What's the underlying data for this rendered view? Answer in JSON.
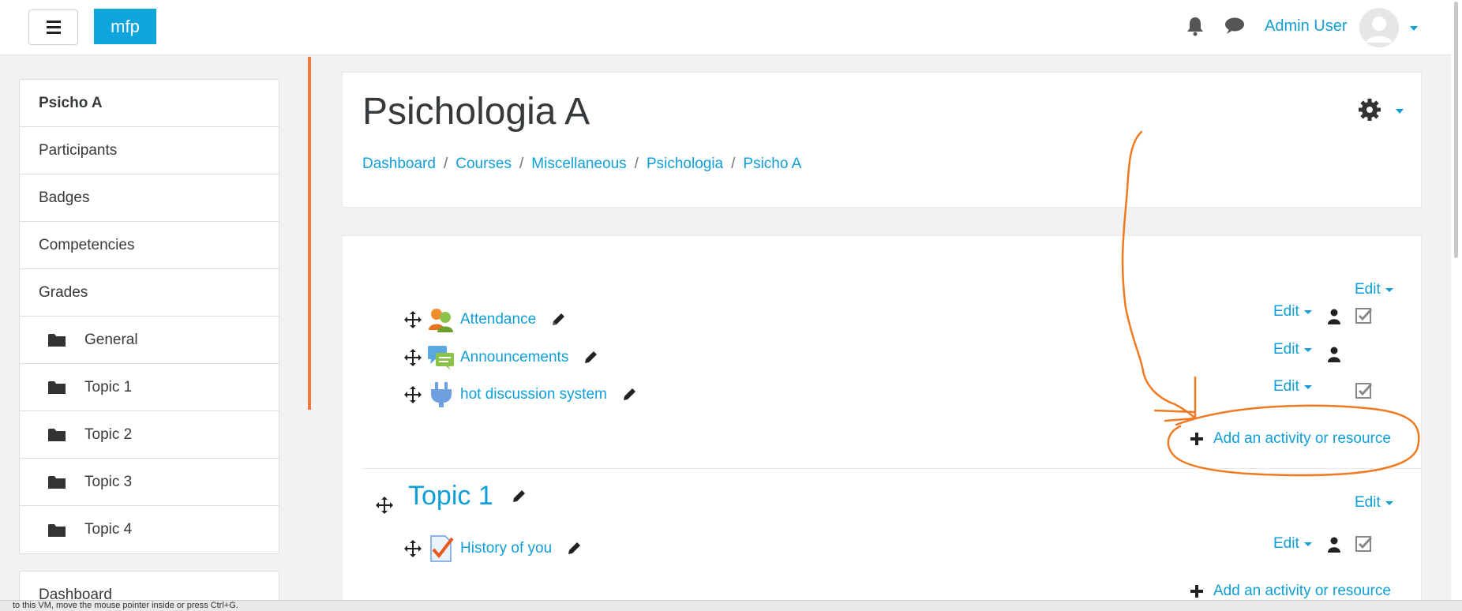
{
  "navbar": {
    "brand": "mfp",
    "user_name": "Admin User",
    "icons": [
      "menu-icon",
      "bell-icon",
      "chat-icon",
      "avatar",
      "caret-down-icon"
    ]
  },
  "sidebar": {
    "items": [
      {
        "label": "Psicho A",
        "bold": true
      },
      {
        "label": "Participants"
      },
      {
        "label": "Badges"
      },
      {
        "label": "Competencies"
      },
      {
        "label": "Grades"
      },
      {
        "label": "General",
        "icon": "folder-icon"
      },
      {
        "label": "Topic 1",
        "icon": "folder-icon"
      },
      {
        "label": "Topic 2",
        "icon": "folder-icon"
      },
      {
        "label": "Topic 3",
        "icon": "folder-icon"
      },
      {
        "label": "Topic 4",
        "icon": "folder-icon"
      }
    ],
    "bottom_items": [
      {
        "label": "Dashboard"
      }
    ]
  },
  "header": {
    "title": "Psichologia A",
    "breadcrumb": [
      "Dashboard",
      "Courses",
      "Miscellaneous",
      "Psichologia",
      "Psicho A"
    ],
    "separator": "/"
  },
  "section0": {
    "edit_label": "Edit",
    "activities": [
      {
        "name": "Attendance",
        "icon": "attendance-icon",
        "edit_label": "Edit",
        "has_person": true,
        "has_check": true
      },
      {
        "name": "Announcements",
        "icon": "forum-icon",
        "edit_label": "Edit",
        "has_person": true,
        "has_check": false
      },
      {
        "name": "hot discussion system",
        "icon": "plugin-icon",
        "edit_label": "Edit",
        "has_person": false,
        "has_check": true
      }
    ],
    "add_label": "Add an activity or resource"
  },
  "section1": {
    "title": "Topic 1",
    "edit_label": "Edit",
    "activities": [
      {
        "name": "History of you",
        "icon": "assignment-icon",
        "edit_label": "Edit",
        "has_person": true,
        "has_check": true
      }
    ],
    "add_label": "Add an activity or resource"
  },
  "statusbar": {
    "text": "to this VM, move the mouse pointer inside or press Ctrl+G."
  },
  "colors": {
    "accent": "#0f9ed7",
    "brand": "#0ea5dc",
    "annotation": "#f07a22"
  }
}
